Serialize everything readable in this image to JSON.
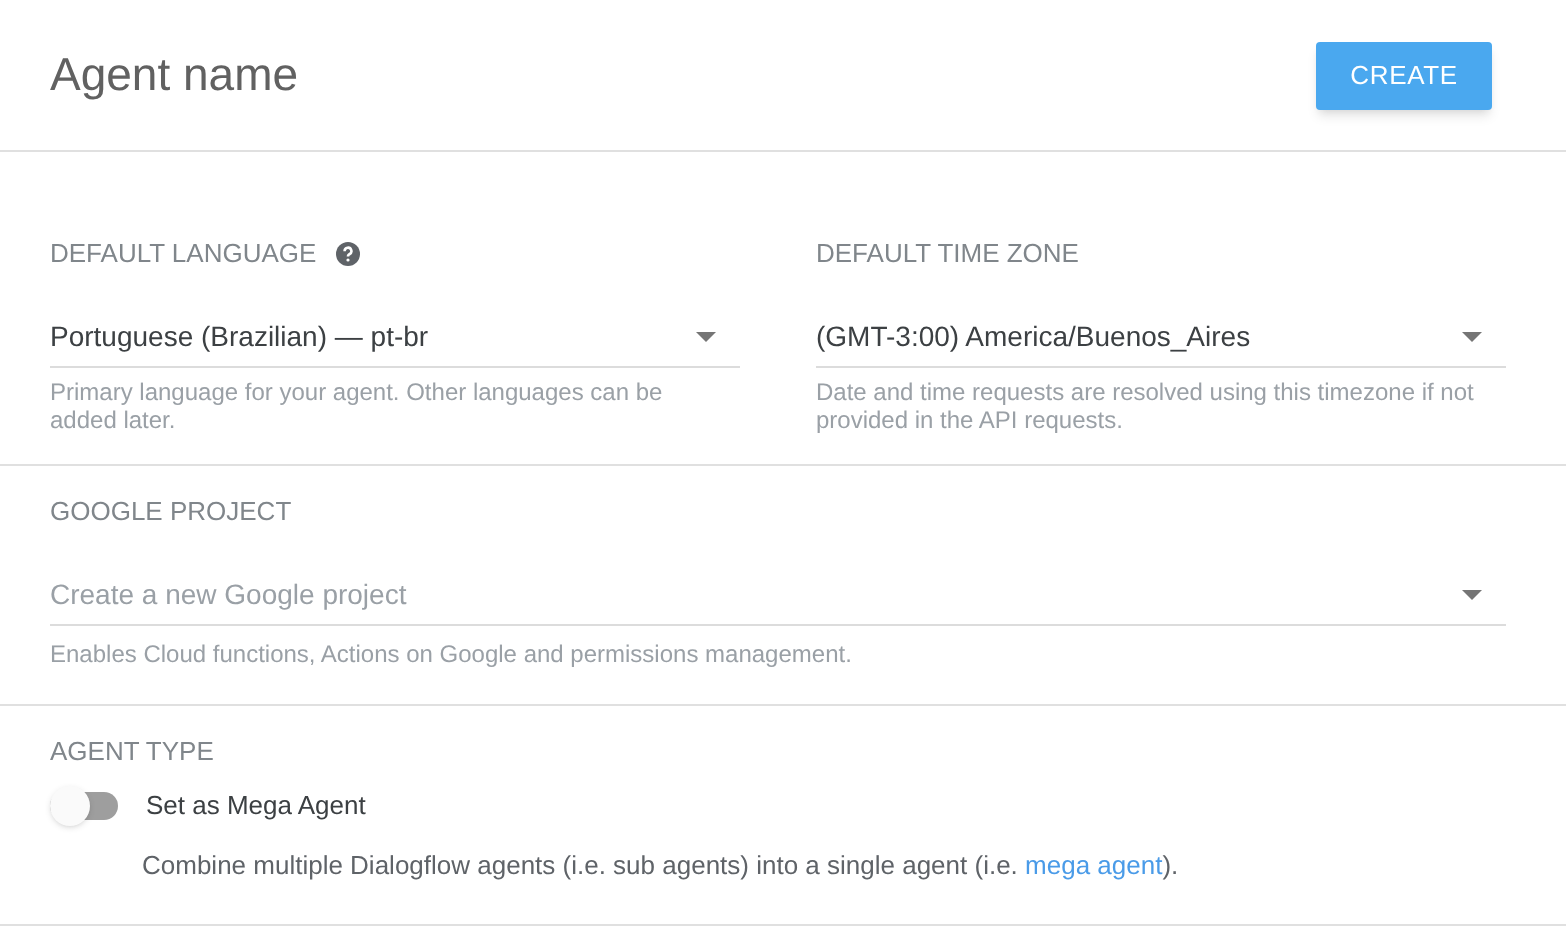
{
  "header": {
    "title": "Agent name",
    "create_button": "CREATE"
  },
  "language": {
    "label": "DEFAULT LANGUAGE",
    "help": true,
    "value": "Portuguese (Brazilian) — pt-br",
    "hint": "Primary language for your agent. Other languages can be added later."
  },
  "time_zone": {
    "label": "DEFAULT TIME ZONE",
    "value": "(GMT-3:00) America/Buenos_Aires",
    "hint": "Date and time requests are resolved using this timezone if not provided in the API requests."
  },
  "google_project": {
    "label": "GOOGLE PROJECT",
    "placeholder": "Create a new Google project",
    "hint": "Enables Cloud functions, Actions on Google and permissions management."
  },
  "agent_type": {
    "label": "AGENT TYPE",
    "toggle_label": "Set as Mega Agent",
    "on": false,
    "description": {
      "before": "Combine multiple Dialogflow agents (i.e. sub agents) into a single agent (i.e. ",
      "link": "mega agent",
      "after": ")."
    }
  }
}
